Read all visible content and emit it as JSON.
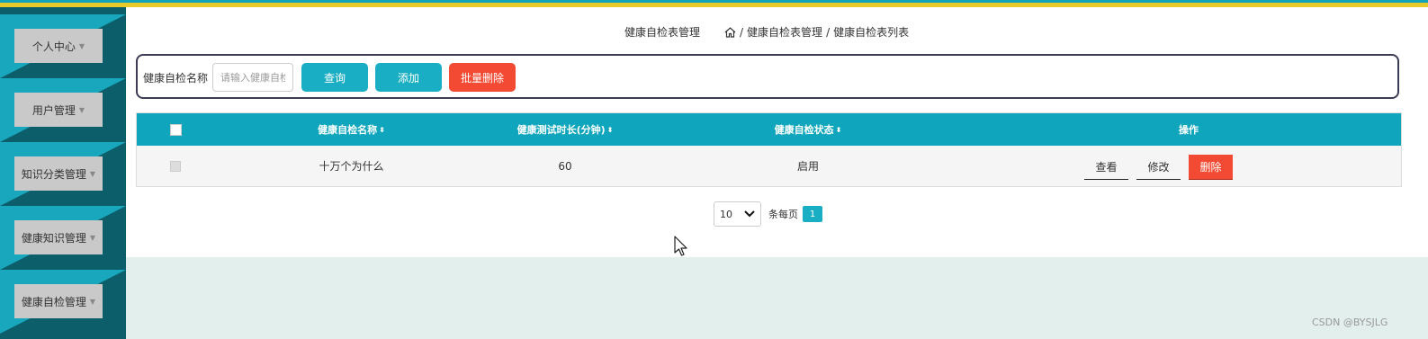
{
  "sidebar": {
    "items": [
      {
        "label": "个人中心"
      },
      {
        "label": "用户管理"
      },
      {
        "label": "知识分类管理"
      },
      {
        "label": "健康知识管理"
      },
      {
        "label": "健康自检管理"
      }
    ]
  },
  "breadcrumb": {
    "title": "健康自检表管理",
    "path": [
      "健康自检表管理",
      "健康自检表列表"
    ],
    "separator": "/"
  },
  "search": {
    "label": "健康自检名称",
    "placeholder": "请输入健康自检名称",
    "value": "",
    "query_button": "查询",
    "add_button": "添加",
    "batch_delete_button": "批量删除"
  },
  "table": {
    "headers": {
      "name": "健康自检名称",
      "duration": "健康测试时长(分钟)",
      "status": "健康自检状态",
      "ops": "操作"
    },
    "rows": [
      {
        "name": "十万个为什么",
        "duration": "60",
        "status": "启用",
        "view": "查看",
        "edit": "修改",
        "delete": "删除"
      }
    ]
  },
  "pagination": {
    "page_size": "10",
    "page_size_label": "条每页",
    "current_page": "1"
  },
  "watermark": "CSDN @BYSJLG",
  "colors": {
    "accent": "#19aec3",
    "danger": "#f34a33",
    "sidebar_dark": "#0b5e6a",
    "sidebar_light": "#19a7bd",
    "top_stripe": "#e8cb2a"
  }
}
